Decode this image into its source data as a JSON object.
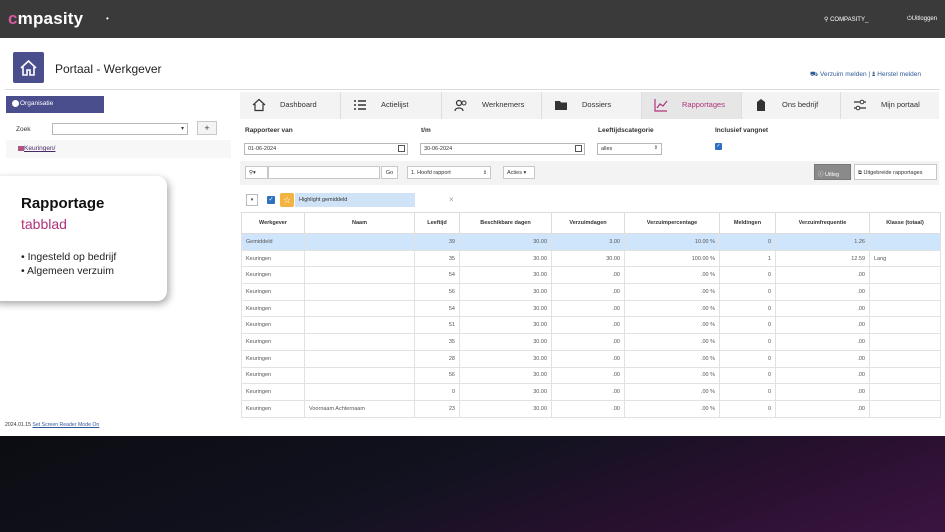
{
  "header": {
    "logo_text": "mpasity",
    "logo_c": "c",
    "logo_sub": "",
    "user": "COMPASITY_",
    "logout": "Uitloggen"
  },
  "page": {
    "title": "Portaal - Werkgever",
    "link_verzuim": "Verzuim melden",
    "link_herstel": "Herstel melden",
    "link_sep": "|"
  },
  "sidebar": {
    "org_tab": "Organisatie",
    "zoek_label": "Zoek",
    "add": "+",
    "tree_item": "Keuringen/"
  },
  "callout": {
    "title": "Rapportage",
    "subtitle": "tabblad",
    "items": [
      "Ingesteld op bedrijf",
      "Algemeen verzuim"
    ]
  },
  "tabs": [
    {
      "label": "Dashboard",
      "icon": "home-icon"
    },
    {
      "label": "Actielijst",
      "icon": "list-icon"
    },
    {
      "label": "Werknemers",
      "icon": "users-icon"
    },
    {
      "label": "Dossiers",
      "icon": "folder-icon"
    },
    {
      "label": "Rapportages",
      "icon": "chart-icon",
      "active": true
    },
    {
      "label": "Ons bedrijf",
      "icon": "building-icon"
    },
    {
      "label": "Mijn portaal",
      "icon": "sliders-icon"
    }
  ],
  "filters": {
    "van_label": "Rapporteer van",
    "van_value": "01-06-2024",
    "tm_label": "t/m",
    "tm_value": "30-06-2024",
    "leeftijd_label": "Leeftijdscategorie",
    "leeftijd_value": "alles",
    "vangnet_label": "Inclusief vangnet"
  },
  "toolbar": {
    "go": "Go",
    "rapport": "1. Hoofd rapport",
    "acties": "Acties",
    "uitleg": "Uitleg",
    "uitgebreid": "Uitgebreide rapportages"
  },
  "highlight": {
    "label": "Highlight gemiddeld"
  },
  "table": {
    "headers": [
      "Werkgever",
      "Naam",
      "Leeftijd",
      "Beschikbare dagen",
      "Verzuimdagen",
      "Verzuimpercentage",
      "Meldingen",
      "Verzuimfrequentie",
      "Klasse (totaal)"
    ],
    "rows": [
      [
        "Gemiddeld",
        "",
        "39",
        "30.00",
        "3.00",
        "10.00 %",
        "0",
        "1.26",
        ""
      ],
      [
        "Keuringen",
        "",
        "35",
        "30.00",
        "30.00",
        "100.00 %",
        "1",
        "12.59",
        "Lang"
      ],
      [
        "Keuringen",
        "",
        "54",
        "30.00",
        ".00",
        ".00 %",
        "0",
        ".00",
        ""
      ],
      [
        "Keuringen",
        "",
        "56",
        "30.00",
        ".00",
        ".00 %",
        "0",
        ".00",
        ""
      ],
      [
        "Keuringen",
        "",
        "54",
        "30.00",
        ".00",
        ".00 %",
        "0",
        ".00",
        ""
      ],
      [
        "Keuringen",
        "",
        "51",
        "30.00",
        ".00",
        ".00 %",
        "0",
        ".00",
        ""
      ],
      [
        "Keuringen",
        "",
        "35",
        "30.00",
        ".00",
        ".00 %",
        "0",
        ".00",
        ""
      ],
      [
        "Keuringen",
        "",
        "28",
        "30.00",
        ".00",
        ".00 %",
        "0",
        ".00",
        ""
      ],
      [
        "Keuringen",
        "",
        "56",
        "30.00",
        ".00",
        ".00 %",
        "0",
        ".00",
        ""
      ],
      [
        "Keuringen",
        "",
        "0",
        "30.00",
        ".00",
        ".00 %",
        "0",
        ".00",
        ""
      ],
      [
        "Keuringen",
        "Voornaam Achternaam",
        "23",
        "30.00",
        ".00",
        ".00 %",
        "0",
        ".00",
        ""
      ]
    ]
  },
  "footer": {
    "version": "2024.01.15",
    "link": "Set Screen Reader Mode On"
  },
  "colors": {
    "accent": "#4a4e8c",
    "brand_pink": "#b0327a",
    "highlight_row": "#cfe5fb"
  }
}
